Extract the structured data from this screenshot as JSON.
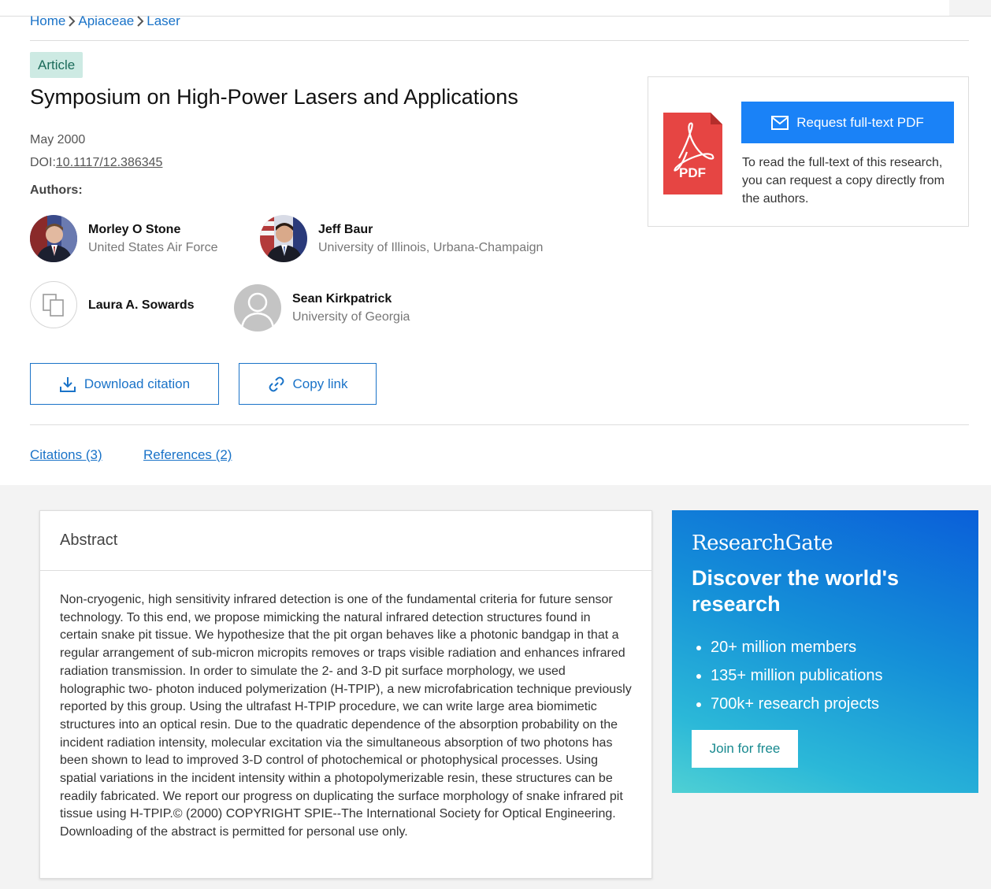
{
  "breadcrumb": {
    "items": [
      "Home",
      "Apiaceae",
      "Laser"
    ]
  },
  "article": {
    "type_badge": "Article",
    "title": "Symposium on High-Power Lasers and Applications",
    "date": "May 2000",
    "doi_label": "DOI:",
    "doi_value": "10.1117/12.386345",
    "authors_label": "Authors:"
  },
  "authors": [
    {
      "name": "Morley O Stone",
      "affiliation": "United States Air Force"
    },
    {
      "name": "Jeff Baur",
      "affiliation": "University of Illinois, Urbana-Champaign"
    },
    {
      "name": "Laura A. Sowards",
      "affiliation": ""
    },
    {
      "name": "Sean Kirkpatrick",
      "affiliation": "University of Georgia"
    }
  ],
  "actions": {
    "download_citation": "Download citation",
    "copy_link": "Copy link"
  },
  "tabs": {
    "citations": "Citations (3)",
    "references": "References (2)"
  },
  "pdf_panel": {
    "icon_label": "PDF",
    "request_button": "Request full-text PDF",
    "note": "To read the full-text of this research, you can request a copy directly from the authors."
  },
  "abstract": {
    "heading": "Abstract",
    "text": "Non-cryogenic, high sensitivity infrared detection is one of the fundamental criteria for future sensor technology. To this end, we propose mimicking the natural infrared detection structures found in certain snake pit tissue. We hypothesize that the pit organ behaves like a photonic bandgap in that a regular arrangement of sub-micron micropits removes or traps visible radiation and enhances infrared radiation transmission. In order to simulate the 2- and 3-D pit surface morphology, we used holographic two- photon induced polymerization (H-TPIP), a new microfabrication technique previously reported by this group. Using the ultrafast H-TPIP procedure, we can write large area biomimetic structures into an optical resin. Due to the quadratic dependence of the absorption probability on the incident radiation intensity, molecular excitation via the simultaneous absorption of two photons has been shown to lead to improved 3-D control of photochemical or photophysical processes. Using spatial variations in the incident intensity within a photopolymerizable resin, these structures can be readily fabricated. We report our progress on duplicating the surface morphology of snake infrared pit tissue using H-TPIP.© (2000) COPYRIGHT SPIE--The International Society for Optical Engineering. Downloading of the abstract is permitted for personal use only."
  },
  "promo": {
    "logo": "ResearchGate",
    "headline": "Discover the world's research",
    "bullets": [
      "20+ million members",
      "135+ million publications",
      "700k+ research projects"
    ],
    "join_button": "Join for free"
  },
  "colors": {
    "link_blue": "#1a73c8",
    "primary_button": "#1a82f7",
    "badge_bg": "#cdeae3",
    "pdf_red": "#e64543",
    "join_text": "#17898f"
  },
  "icons": {
    "breadcrumb_separator": "chevron-right-icon",
    "download": "download-icon",
    "copy_link": "link-icon",
    "request_pdf": "envelope-icon",
    "pdf": "pdf-file-icon",
    "avatar_placeholder": "person-silhouette-icon",
    "avatar_no_photo": "documents-icon"
  }
}
